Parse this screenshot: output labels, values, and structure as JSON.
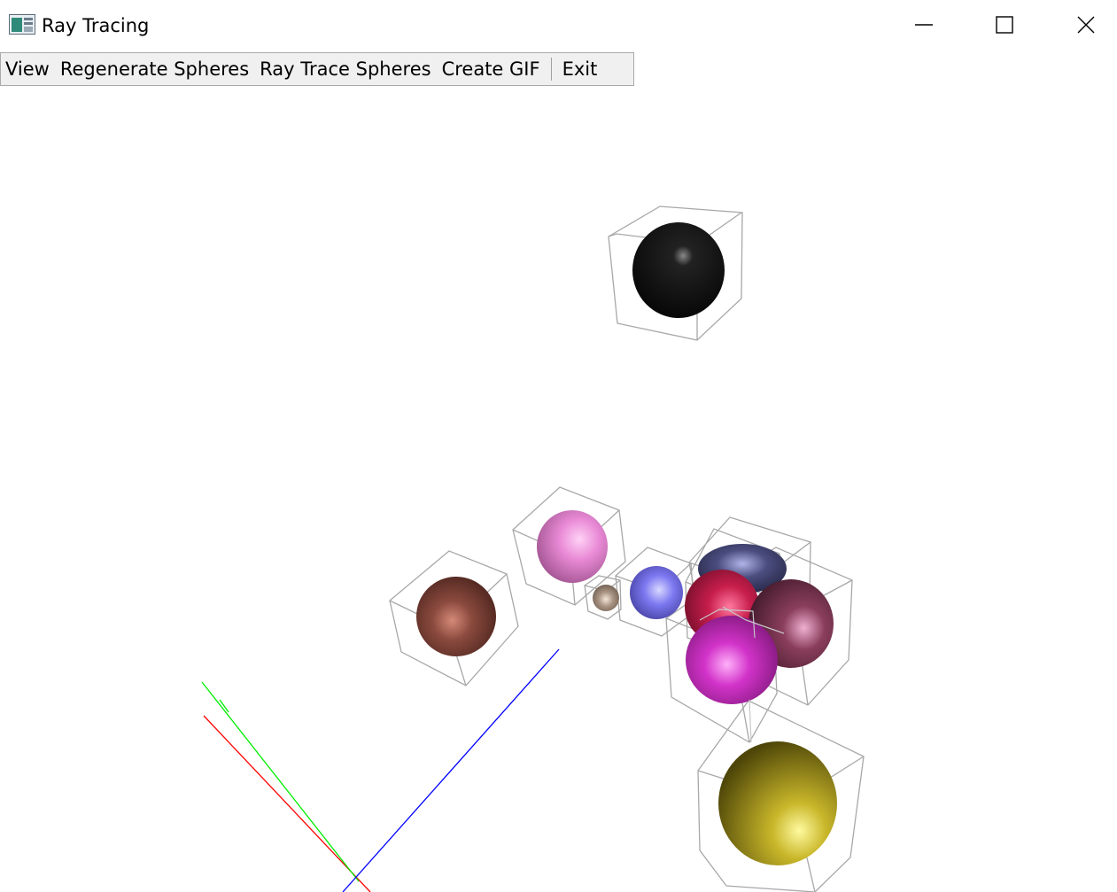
{
  "window": {
    "title": "Ray Tracing",
    "controls": {
      "minimize": "minimize-icon",
      "maximize": "maximize-icon",
      "close": "close-icon"
    }
  },
  "menu": {
    "items": [
      {
        "label": "View"
      },
      {
        "label": "Regenerate Spheres"
      },
      {
        "label": "Ray Trace Spheres"
      },
      {
        "label": "Create GIF"
      },
      {
        "label": "Exit"
      }
    ]
  },
  "scene": {
    "background": "#ffffff",
    "axis_colors": {
      "x": "#ff0000",
      "y": "#00ff00",
      "z": "#0000ff"
    },
    "bounding_box_color": "#a0a0a0",
    "sphere_colors": [
      "#111111",
      "#e98ad6",
      "#8b4a3e",
      "#a89282",
      "#7c78f0",
      "#4b4d7f",
      "#c81e4c",
      "#8a3e5c",
      "#d233c9",
      "#c9b72a"
    ]
  }
}
